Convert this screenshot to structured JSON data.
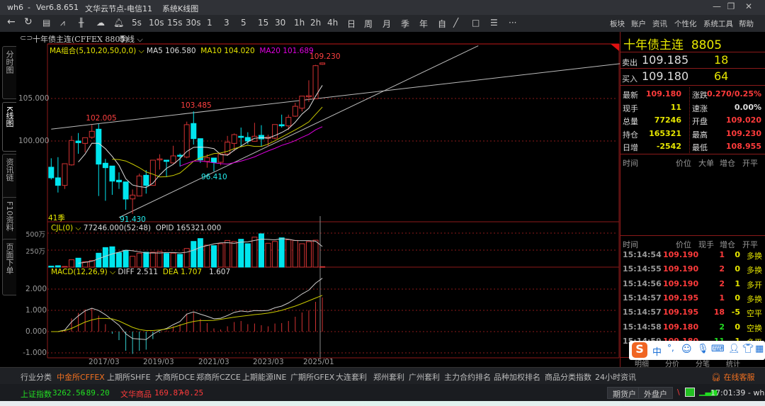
{
  "titlebar": {
    "app": "wh6",
    "version": "Ver6.8.651",
    "node": "文华云节点-电信11",
    "view": "系统K线图",
    "sep": "-"
  },
  "toolbar": {
    "icons": [
      "back-icon",
      "refresh-icon",
      "report-icon",
      "line-chart-icon",
      "candle-icon",
      "cloud-icon",
      "bell-icon"
    ],
    "periods": [
      "5s",
      "10s",
      "15s",
      "30s",
      "1",
      "3",
      "5",
      "15",
      "30",
      "1h",
      "2h",
      "4h",
      "日",
      "周",
      "月",
      "季",
      "年",
      "自"
    ],
    "tools": [
      "draw-line-icon",
      "rectangle-icon",
      "layout-icon",
      "more-icon"
    ],
    "menu": [
      "板块",
      "账户",
      "资讯",
      "个性化",
      "系统工具",
      "帮助"
    ]
  },
  "symbol": {
    "title": "十年债主连(CFFEX  8805)",
    "period": "季线"
  },
  "lefttabs": [
    "分时图",
    "K线图",
    "资讯链",
    "F10资料",
    "页面下单"
  ],
  "price_panel": {
    "legend_ma": "MA组合(5,10,20,50,0,0)",
    "ma5": "MA5 106.580",
    "ma10": "MA10 104.020",
    "ma20": "MA20 101.689",
    "count": "41季",
    "yticks": [
      "105.000",
      "100.000"
    ],
    "annotations": [
      {
        "text": "102.005",
        "price": 102.005,
        "idx": 7,
        "color": "red"
      },
      {
        "text": "103.485",
        "price": 103.485,
        "idx": 21,
        "color": "red"
      },
      {
        "text": "96.410",
        "price": 96.41,
        "idx": 24,
        "color": "cyan"
      },
      {
        "text": "91.430",
        "price": 91.43,
        "idx": 12,
        "color": "cyan"
      },
      {
        "text": "109.230",
        "price": 109.23,
        "idx": 40,
        "color": "red"
      }
    ]
  },
  "volume_panel": {
    "legend": "CJL(0)",
    "value": "77246.000(52:48)",
    "opid": "OPID 165321.000",
    "yticks": [
      "500万",
      "250万"
    ]
  },
  "macd_panel": {
    "legend": "MACD(12,26,9)",
    "diff": "DIFF 2.511",
    "dea": "DEA 1.707",
    "macd": "1.607",
    "yticks": [
      "2.000",
      "1.000",
      "0.000",
      "-1.000"
    ]
  },
  "xaxis": [
    "2017/03",
    "2019/03",
    "2021/03",
    "2023/03",
    "2025/01"
  ],
  "colors": {
    "up": "#d23232",
    "down": "#00e5ee",
    "ma5": "#dddddd",
    "ma10": "#c8c800",
    "ma20": "#e000e0",
    "grid": "#8b1a1a"
  },
  "chart_data": {
    "type": "candlestick",
    "period": "quarterly",
    "ohlc": [
      [
        96.92,
        97.97,
        95.47,
        95.67
      ],
      [
        95.67,
        98.1,
        93.94,
        94.78
      ],
      [
        94.78,
        97.33,
        94.36,
        97.33
      ],
      [
        97.19,
        100.6,
        97.1,
        100.06
      ],
      [
        100.0,
        100.94,
        98.5,
        99.8
      ],
      [
        99.72,
        100.39,
        98.67,
        100.39
      ],
      [
        100.44,
        101.9,
        100.25,
        101.14
      ],
      [
        101.39,
        102.005,
        93.53,
        97.28
      ],
      [
        97.39,
        97.89,
        92.97,
        96.86
      ],
      [
        97.06,
        97.06,
        93.67,
        95.28
      ],
      [
        95.39,
        96.31,
        94.36,
        95.19
      ],
      [
        95.19,
        95.19,
        91.92,
        93.17
      ],
      [
        93.19,
        94.3,
        91.43,
        93.64
      ],
      [
        93.53,
        96.17,
        93.53,
        95.89
      ],
      [
        95.97,
        96.58,
        93.81,
        94.78
      ],
      [
        94.78,
        97.75,
        94.78,
        97.75
      ],
      [
        97.8,
        98.44,
        96.64,
        97.9
      ],
      [
        97.75,
        97.75,
        95.75,
        97.6
      ],
      [
        97.42,
        99.44,
        97.42,
        98.25
      ],
      [
        98.33,
        98.53,
        97.0,
        98.2
      ],
      [
        98.11,
        102.28,
        97.97,
        101.92
      ],
      [
        102.06,
        103.485,
        99.58,
        100.28
      ],
      [
        100.28,
        100.28,
        97.42,
        97.78
      ],
      [
        97.6,
        98.44,
        96.86,
        98.03
      ],
      [
        98.0,
        98.0,
        96.41,
        97.5
      ],
      [
        97.5,
        98.47,
        97.14,
        98.47
      ],
      [
        98.47,
        100.6,
        98.25,
        99.86
      ],
      [
        99.72,
        100.89,
        98.8,
        100.75
      ],
      [
        100.56,
        101.58,
        99.36,
        100.42
      ],
      [
        100.42,
        101.03,
        99.64,
        100.0
      ],
      [
        99.97,
        102.14,
        99.92,
        100.56
      ],
      [
        100.67,
        101.86,
        99.36,
        100.25
      ],
      [
        100.31,
        100.75,
        99.36,
        100.47
      ],
      [
        100.33,
        101.94,
        100.19,
        101.94
      ],
      [
        101.92,
        103.1,
        101.58,
        101.78
      ],
      [
        101.78,
        103.1,
        101.3,
        102.78
      ],
      [
        102.92,
        104.5,
        102.83,
        104.08
      ],
      [
        103.86,
        105.28,
        103.47,
        105.28
      ],
      [
        105.25,
        107.14,
        104.6,
        105.33
      ],
      [
        104.97,
        108.95,
        104.97,
        108.86
      ],
      [
        109.02,
        109.23,
        108.955,
        109.18
      ]
    ],
    "volume_wan": [
      15,
      21,
      10,
      108,
      132,
      80,
      97,
      205,
      288,
      299,
      212,
      247,
      160,
      205,
      219,
      219,
      229,
      201,
      205,
      188,
      274,
      378,
      420,
      323,
      316,
      344,
      392,
      375,
      410,
      344,
      441,
      490,
      351,
      378,
      431,
      403,
      392,
      344,
      375,
      396,
      7.7
    ],
    "macd_hist": [
      0,
      0,
      0.05,
      0.62,
      0.88,
      1.05,
      1.1,
      0.75,
      0.35,
      -0.1,
      -0.4,
      -0.9,
      -1.05,
      -0.9,
      -0.85,
      -0.35,
      -0.05,
      0.05,
      0.25,
      0.35,
      0.85,
      0.9,
      0.6,
      0.4,
      0.15,
      0.1,
      0.25,
      0.45,
      0.5,
      0.35,
      0.38,
      0.3,
      0.25,
      0.38,
      0.4,
      0.5,
      0.7,
      0.9,
      1.0,
      1.4,
      1.607
    ],
    "dea": [
      0,
      0,
      0.05,
      0.15,
      0.3,
      0.45,
      0.55,
      0.62,
      0.62,
      0.6,
      0.5,
      0.35,
      0.2,
      0.1,
      0.05,
      0.05,
      0.08,
      0.12,
      0.2,
      0.3,
      0.4,
      0.48,
      0.52,
      0.52,
      0.53,
      0.58,
      0.63,
      0.68,
      0.72,
      0.76,
      0.8,
      0.83,
      0.87,
      0.93,
      1.0,
      1.1,
      1.2,
      1.32,
      1.45,
      1.58,
      1.707
    ],
    "trendlines": [
      {
        "from": [
          0,
          101.4
        ],
        "to": [
          84,
          109.1
        ]
      },
      {
        "from": [
          10,
          91.0
        ],
        "to": [
          63,
          111.2
        ]
      }
    ],
    "ylim_price": [
      90.8,
      111.2
    ],
    "ylim_volume_wan": [
      0,
      560
    ],
    "ylim_macd": [
      -1.2,
      2.8
    ]
  },
  "quote": {
    "name": "十年债主连",
    "code": "8805",
    "ask_label": "卖出",
    "ask": "109.185",
    "ask_vol": "18",
    "bid_label": "买入",
    "bid": "109.180",
    "bid_vol": "64",
    "stats": [
      [
        "最新",
        "109.180",
        "涨跌",
        "0.270/0.25%"
      ],
      [
        "现手",
        "11",
        "速涨",
        "0.00%"
      ],
      [
        "总量",
        "77246",
        "开盘",
        "109.020"
      ],
      [
        "持仓",
        "165321",
        "最高",
        "109.230"
      ],
      [
        "日增",
        "-2542",
        "最低",
        "108.955"
      ]
    ],
    "big_header": [
      "时间",
      "价位",
      "大单",
      "增仓",
      "开平"
    ],
    "trade_header": [
      "时间",
      "价位",
      "现手",
      "增仓",
      "开平"
    ],
    "trades": [
      [
        "15:14:54",
        "109.190",
        "1",
        "0",
        "多换"
      ],
      [
        "15:14:55",
        "109.190",
        "2",
        "0",
        "多换"
      ],
      [
        "15:14:56",
        "109.190",
        "2",
        "1",
        "多开"
      ],
      [
        "15:14:57",
        "109.195",
        "1",
        "0",
        "多换"
      ],
      [
        "15:14:57",
        "109.195",
        "18",
        "-5",
        "空平"
      ],
      [
        "15:14:58",
        "109.180",
        "2",
        "0",
        "空换"
      ],
      [
        "15:14:59",
        "109.180",
        "11",
        "-1",
        "多平"
      ]
    ],
    "tabs": [
      "明细",
      "分价",
      "分笔",
      "统计"
    ]
  },
  "bottomtabs": [
    "行业分类",
    "中金所CFFEX",
    "上期所SHFE",
    "大商所DCE",
    "郑商所CZCE",
    "上期能源INE",
    "广期所GFEX",
    "大连套利",
    "郑州套利",
    "广州套利",
    "主力合约排名",
    "品种加权排名",
    "商品分类指数",
    "24小时资讯"
  ],
  "service": "在线客服",
  "status": {
    "idx1_name": "上证指数",
    "idx1_val": "3262.56",
    "idx1_chg": "-89.20",
    "idx2_name": "文华商品",
    "idx2_val": "169.87",
    "idx2_chg": "+0.25",
    "btn1": "期货户",
    "btn2": "外盘户",
    "time": "17:01:39 - wh"
  },
  "ime": {
    "lang": "中",
    "punct": "°,"
  }
}
